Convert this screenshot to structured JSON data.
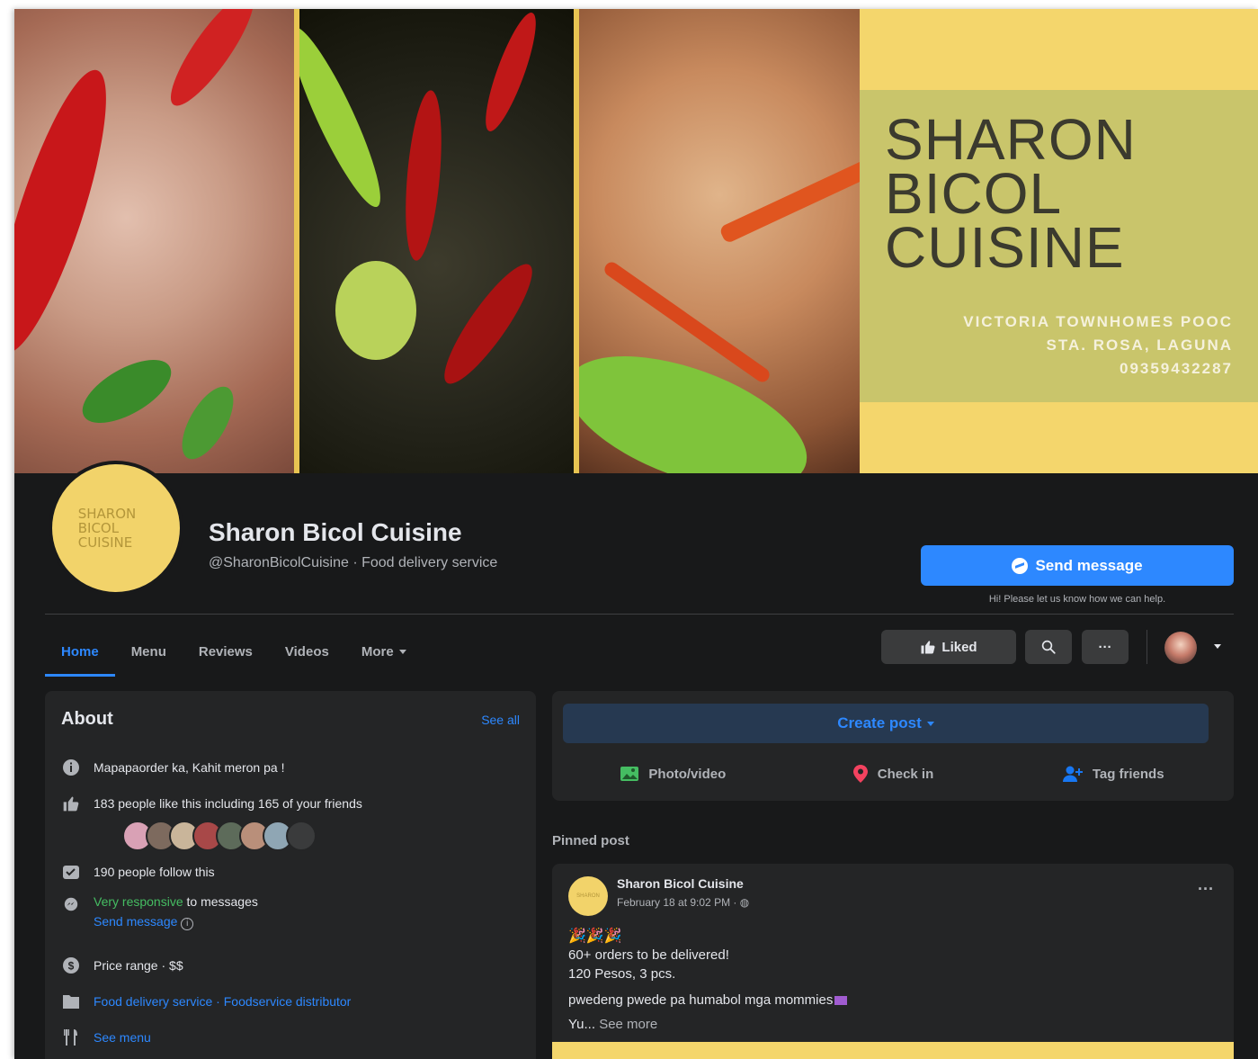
{
  "cover": {
    "title_lines": [
      "SHARON",
      "BICOL",
      "CUISINE"
    ],
    "address_lines": [
      "VICTORIA TOWNHOMES POOC",
      "STA. ROSA, LAGUNA",
      "09359432287"
    ]
  },
  "profile": {
    "logo_lines": [
      "SHARON",
      "BICOL",
      "CUISINE"
    ],
    "name": "Sharon Bicol Cuisine",
    "subtitle": "@SharonBicolCuisine · Food delivery service",
    "send_message": "Send message",
    "send_hint": "Hi! Please let us know how we can help."
  },
  "tabs": [
    {
      "label": "Home",
      "active": true
    },
    {
      "label": "Menu",
      "active": false
    },
    {
      "label": "Reviews",
      "active": false
    },
    {
      "label": "Videos",
      "active": false
    },
    {
      "label": "More",
      "active": false
    }
  ],
  "actions": {
    "liked": "Liked",
    "more": "···"
  },
  "about": {
    "title": "About",
    "see_all": "See all",
    "tagline": "Mapapaorder ka, Kahit meron pa !",
    "likes": "183 people like this including 165 of your friends",
    "follows": "190 people follow this",
    "responsive": "Very responsive",
    "responsive_suffix": " to messages",
    "send_message": "Send message",
    "price": "Price range · $$",
    "category_1": "Food delivery service",
    "category_sep": " · ",
    "category_2": "Foodservice distributor",
    "see_menu": "See menu"
  },
  "create_post": {
    "label": "Create post",
    "photo": "Photo/video",
    "checkin": "Check in",
    "tag": "Tag friends"
  },
  "pinned": {
    "label": "Pinned post",
    "author": "Sharon Bicol Cuisine",
    "date": "February 18 at 9:02 PM ·",
    "lines": [
      "60+ orders to be delivered!",
      "120 Pesos, 3 pcs.",
      "pwedeng pwede pa humabol mga mommies"
    ],
    "truncated": "Yu...",
    "see_more": "See more"
  },
  "colors": {
    "accent": "#2d88ff",
    "background": "#18191a",
    "card": "#242526",
    "brand_yellow": "#f4d66c",
    "responsive_green": "#45bd62"
  }
}
